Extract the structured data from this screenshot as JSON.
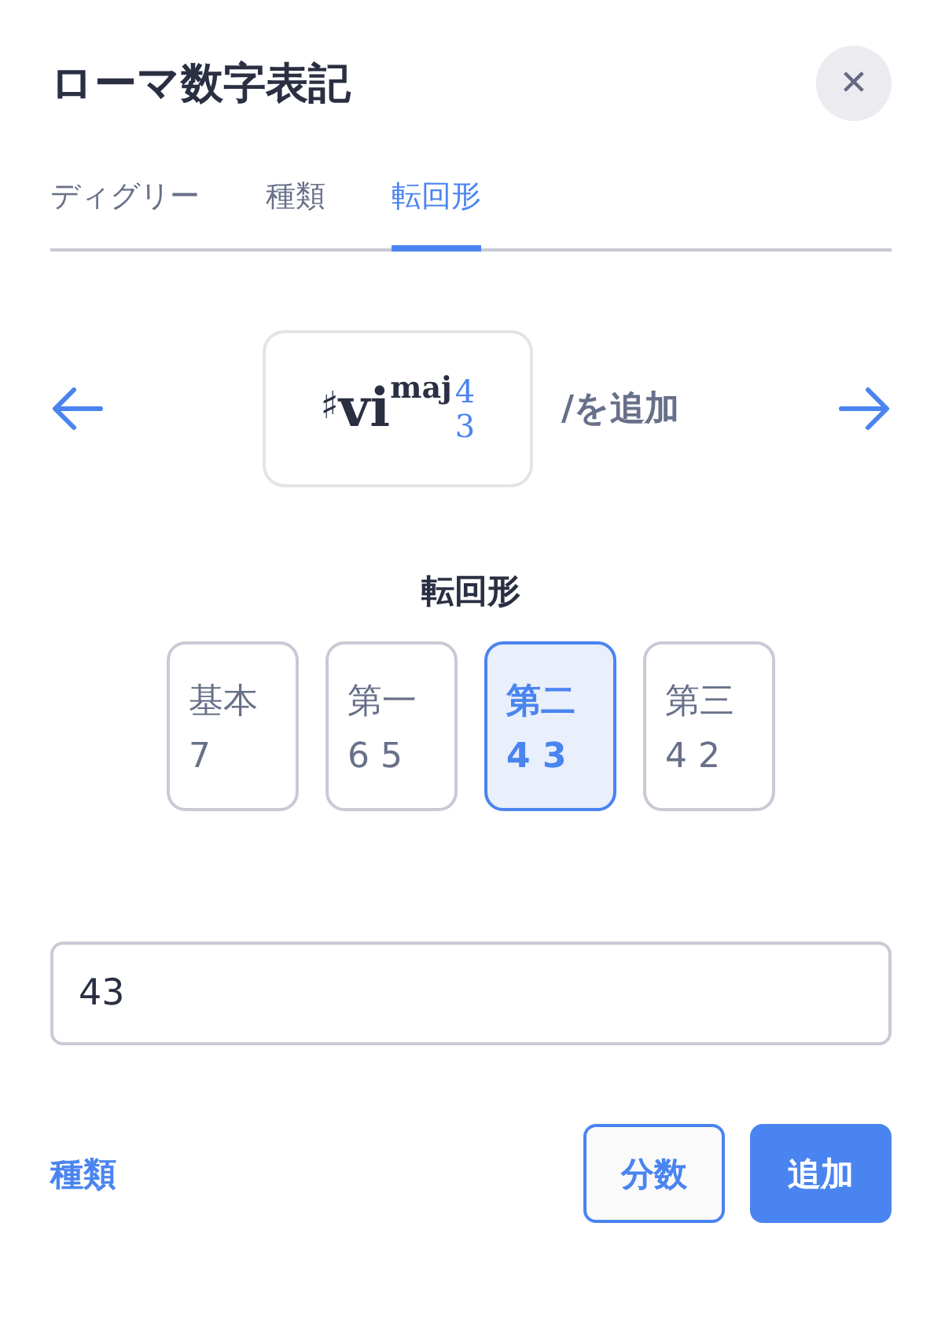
{
  "dialog": {
    "title": "ローマ数字表記",
    "close": "✕"
  },
  "tabs": [
    {
      "label": "ディグリー",
      "selected": false
    },
    {
      "label": "種類",
      "selected": false
    },
    {
      "label": "転回形",
      "selected": true
    }
  ],
  "chord": {
    "accidental": "♯",
    "numeral": "vi",
    "quality": "maj",
    "figures": [
      "4",
      "3"
    ],
    "suffix": "/を追加"
  },
  "inversion": {
    "heading": "転回形",
    "options": [
      {
        "label": "基本",
        "figures": "7",
        "selected": false
      },
      {
        "label": "第一",
        "figures": "6 5",
        "selected": false
      },
      {
        "label": "第二",
        "figures": "4 3",
        "selected": true
      },
      {
        "label": "第三",
        "figures": "4 2",
        "selected": false
      }
    ]
  },
  "field": {
    "value": "43"
  },
  "footer": {
    "link": "種類",
    "buttons": [
      {
        "label": "分数",
        "kind": "secondary"
      },
      {
        "label": "追加",
        "kind": "primary"
      }
    ]
  }
}
